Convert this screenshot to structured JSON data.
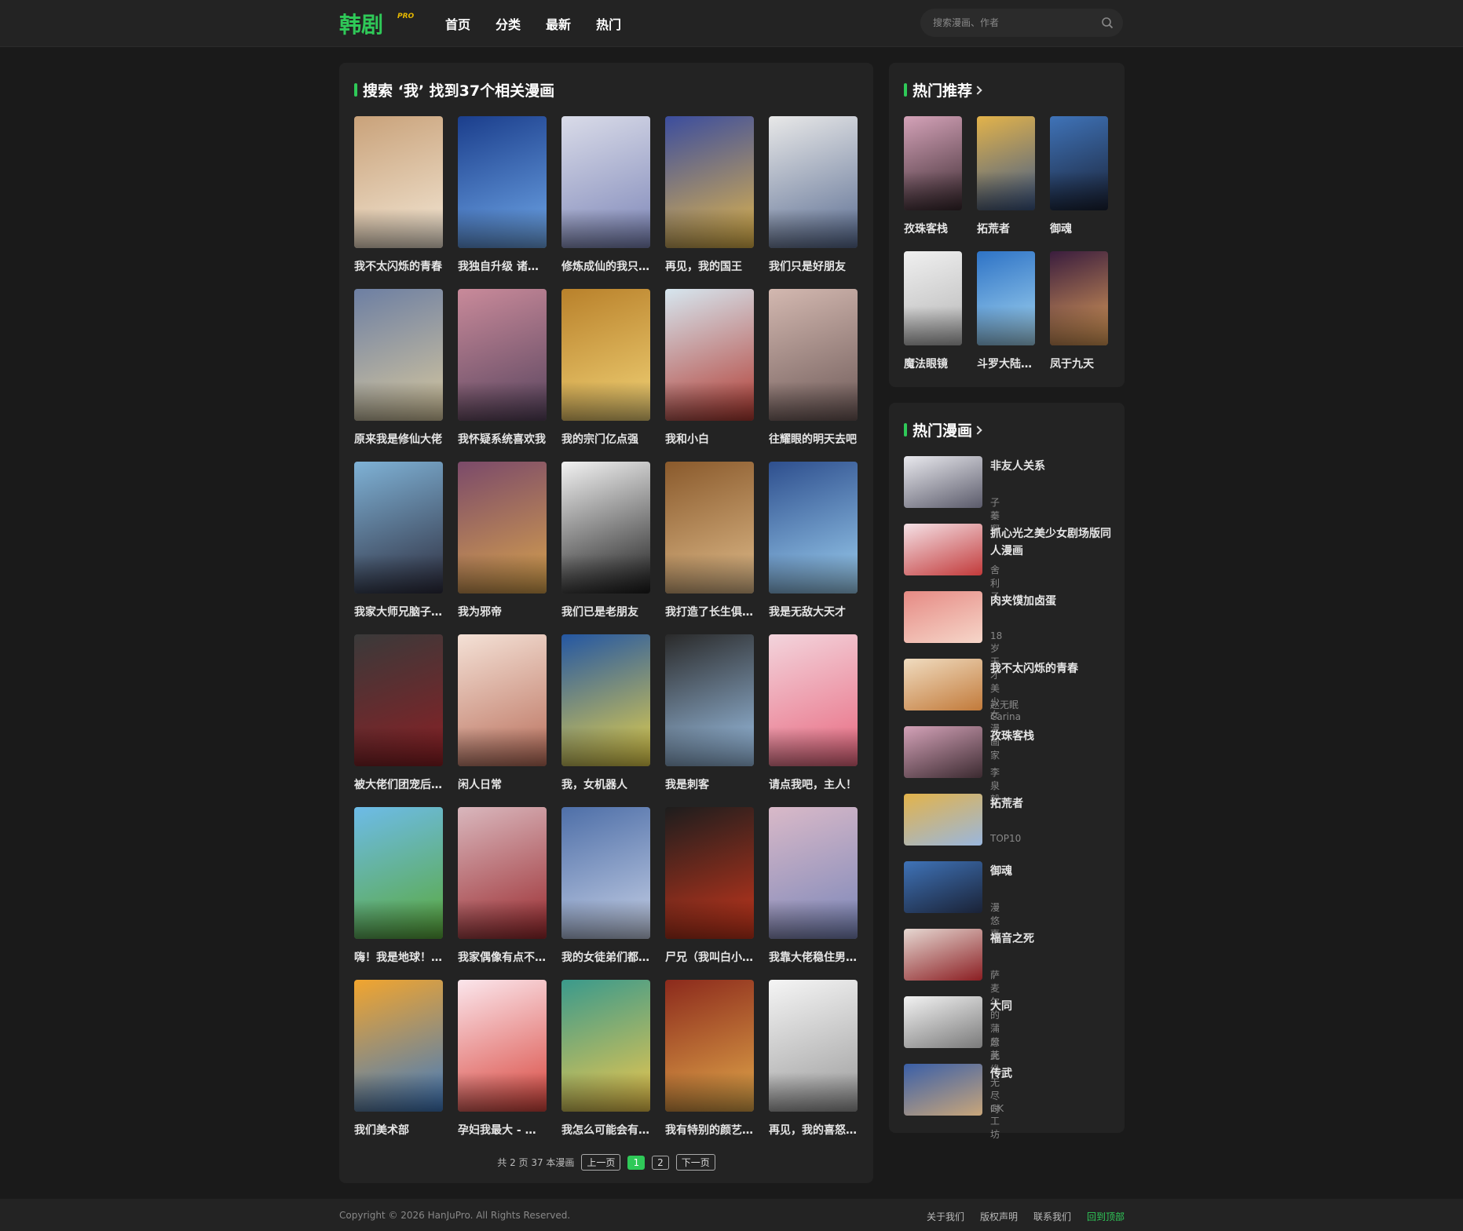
{
  "site": {
    "logo": "韩剧",
    "logo_badge": "PRO"
  },
  "nav": [
    "首页",
    "分类",
    "最新",
    "热门"
  ],
  "search": {
    "placeholder": "搜索漫画、作者"
  },
  "results": {
    "title": "搜索 ‘我’ 找到37个相关漫画",
    "items": [
      {
        "name": "我不太闪烁的青春",
        "c1": "#c9a27a",
        "c2": "#f3e7d5"
      },
      {
        "name": "我独自升级 诸神黄昏",
        "c1": "#1b3e8c",
        "c2": "#6fa7e8"
      },
      {
        "name": "修炼成仙的我只想养成女徒弟",
        "c1": "#d9dbe8",
        "c2": "#7d86b8"
      },
      {
        "name": "再见，我的国王",
        "c1": "#3b4d9e",
        "c2": "#e2b64a"
      },
      {
        "name": "我们只是好朋友",
        "c1": "#e8e8e8",
        "c2": "#5a6d92"
      },
      {
        "name": "原来我是修仙大佬",
        "c1": "#6d7fa3",
        "c2": "#d7c89f"
      },
      {
        "name": "我怀疑系统喜欢我",
        "c1": "#c98a9a",
        "c2": "#58445e"
      },
      {
        "name": "我的宗门亿点强",
        "c1": "#b9812b",
        "c2": "#f1d276"
      },
      {
        "name": "我和小白",
        "c1": "#d6e6ef",
        "c2": "#b23b32"
      },
      {
        "name": "往耀眼的明天去吧",
        "c1": "#d3b8b0",
        "c2": "#6e5a58"
      },
      {
        "name": "我家大师兄脑子有坑",
        "c1": "#7fb2d6",
        "c2": "#2d2d3e"
      },
      {
        "name": "我为邪帝",
        "c1": "#7b4a6a",
        "c2": "#d7a24d"
      },
      {
        "name": "我们已是老朋友",
        "c1": "#f2f2f2",
        "c2": "#1c1c1c"
      },
      {
        "name": "我打造了长生俱乐部",
        "c1": "#8a5a2c",
        "c2": "#dfbb8a"
      },
      {
        "name": "我是无敌大天才",
        "c1": "#2e4f8e",
        "c2": "#9ccff0"
      },
      {
        "name": "被大佬们团宠后我野翻了",
        "c1": "#3a3a3a",
        "c2": "#8b1f24"
      },
      {
        "name": "闲人日常",
        "c1": "#f4e1d6",
        "c2": "#b96e5a"
      },
      {
        "name": "我，女机器人",
        "c1": "#2457a3",
        "c2": "#e6d14a"
      },
      {
        "name": "我是刺客",
        "c1": "#2a2a2a",
        "c2": "#9ec3e8"
      },
      {
        "name": "请点我吧，主人！",
        "c1": "#f3d4dc",
        "c2": "#e8687f"
      },
      {
        "name": "嗨！我是地球！我就是地球！",
        "c1": "#6dbbe8",
        "c2": "#5aa93a"
      },
      {
        "name": "我家偶像有点不对劲",
        "c1": "#d9b7bd",
        "c2": "#9a2a2e"
      },
      {
        "name": "我的女徒弟们都是未来诸天大佬",
        "c1": "#4e6fa8",
        "c2": "#c6d0e6"
      },
      {
        "name": "尸兄（我叫白小飞）",
        "c1": "#1d1d1d",
        "c2": "#c8361c"
      },
      {
        "name": "我靠大佬稳住男团C位",
        "c1": "#d9b9c8",
        "c2": "#7a86b9"
      },
      {
        "name": "我们美术部",
        "c1": "#f2a52e",
        "c2": "#3f7ac1"
      },
      {
        "name": "孕妇我最大 - 小龟的孕期时光",
        "c1": "#fbe6ec",
        "c2": "#d9463d"
      },
      {
        "name": "我怎么可能会有那么多女朋友",
        "c1": "#3a9a8c",
        "c2": "#f0c84c"
      },
      {
        "name": "我有特别的颜艺技巧",
        "c1": "#8c2a1c",
        "c2": "#e2a84a"
      },
      {
        "name": "再见，我的喜怒哀乐",
        "c1": "#f5f5f5",
        "c2": "#9a9a9a"
      }
    ]
  },
  "pagination": {
    "info": "共 2 页 37 本漫画",
    "prev": "上一页",
    "pages": [
      "1",
      "2"
    ],
    "next": "下一页"
  },
  "recommend": {
    "title": "热门推荐",
    "items": [
      {
        "name": "孜珠客栈",
        "c1": "#d4a2b8",
        "c2": "#3b2a30"
      },
      {
        "name": "拓荒者",
        "c1": "#e3b34a",
        "c2": "#3e5a8a"
      },
      {
        "name": "御魂",
        "c1": "#3f73b8",
        "c2": "#1a2236"
      },
      {
        "name": "魔法眼镜",
        "c1": "#f0f0f0",
        "c2": "#b5b5b5"
      },
      {
        "name": "斗罗大陆之天使印记",
        "c1": "#2e73c6",
        "c2": "#a6d8f2"
      },
      {
        "name": "凤于九天",
        "c1": "#3a1d3e",
        "c2": "#e0a05a"
      }
    ]
  },
  "hot": {
    "title": "热门漫画",
    "items": [
      {
        "title": "非友人关系",
        "author": "子蓁啊",
        "c1": "#e9e9ee",
        "c2": "#5a5a6a"
      },
      {
        "title": "抓心光之美少女剧场版同人漫画",
        "author": "舍利子",
        "c1": "#f5e1e6",
        "c2": "#c23a3a"
      },
      {
        "title": "肉夹馍加卤蛋",
        "author": "18岁天才美少女漫画家",
        "c1": "#e68a84",
        "c2": "#f6d6c9"
      },
      {
        "title": "我不太闪烁的青春",
        "author": "赵无眠Carina",
        "c1": "#f0dcc0",
        "c2": "#c27a3a"
      },
      {
        "title": "孜珠客栈",
        "author": "李泉毅",
        "c1": "#d4a2b8",
        "c2": "#3b2a30"
      },
      {
        "title": "拓荒者",
        "author": "TOP10",
        "c1": "#e3b34a",
        "c2": "#9ab7de"
      },
      {
        "title": "御魂",
        "author": "漫悠嘉",
        "c1": "#3f73b8",
        "c2": "#1a2236"
      },
      {
        "title": "福音之死",
        "author": "萨麦尔的蒲公英",
        "c1": "#e6d8d2",
        "c2": "#8b1e22"
      },
      {
        "title": "大同",
        "author": "愿此缘无尽时",
        "c1": "#f2f2f2",
        "c2": "#7a7a7a"
      },
      {
        "title": "传武",
        "author": "GK工坊",
        "c1": "#3a5fa8",
        "c2": "#c9a67a"
      }
    ]
  },
  "footer": {
    "copyright": "Copyright © 2026 HanJuPro. All Rights Reserved.",
    "links": [
      "关于我们",
      "版权声明",
      "联系我们"
    ],
    "top": "回到顶部"
  },
  "colors": {
    "accent": "#2fc958",
    "bg": "#1a1a1a",
    "panel": "#232323"
  }
}
